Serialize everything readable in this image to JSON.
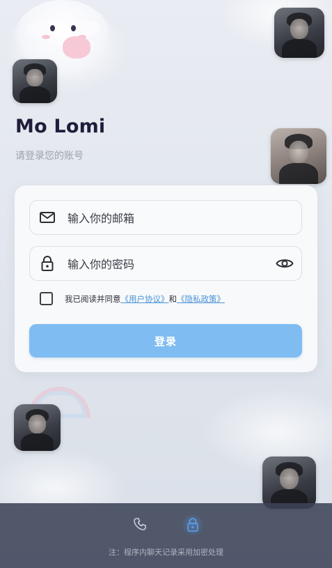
{
  "app": {
    "brand": "Mo Lomi",
    "subtitle": "请登录您的账号"
  },
  "form": {
    "email_placeholder": "输入你的邮箱",
    "password_placeholder": "输入你的密码",
    "agree_prefix": "我已阅读并同意",
    "user_agreement": "《用户协议》",
    "agree_and": "和",
    "privacy_policy": "《隐私政策》",
    "agree_checked": false,
    "login_label": "登录"
  },
  "bottom": {
    "note": "注：程序内聊天记录采用加密处理",
    "active_tab": "lock"
  },
  "icons": {
    "email": "mail-icon",
    "password": "lock-icon",
    "toggle": "eye-icon",
    "nav_phone": "phone-icon",
    "nav_lock": "lock-icon"
  },
  "colors": {
    "accent": "#7fbcf1",
    "link": "#4a93d6",
    "brand_text": "#1f1d3b",
    "bottom_bar": "#3c4458",
    "nav_active": "#5a9be6"
  }
}
